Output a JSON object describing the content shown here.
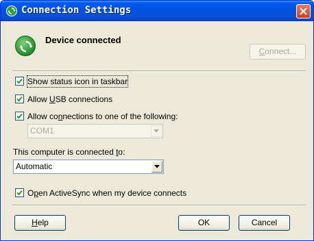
{
  "window": {
    "title": "Connection Settings",
    "colors": {
      "titlebar": "#0054e3",
      "close": "#c9401e",
      "face": "#ece9d8",
      "icon_green": "#1f8f2b"
    },
    "icons": [
      "sync-icon",
      "close-icon"
    ]
  },
  "status": {
    "title": "Device connected",
    "connect_button": {
      "label_pre": "",
      "mnemonic": "C",
      "label_post": "onnect...",
      "enabled": false
    }
  },
  "options": {
    "show_status_icon": {
      "label": "Show status icon in taskbar",
      "checked": true
    },
    "allow_usb": {
      "label_pre": "Allow ",
      "mnemonic": "U",
      "label_post": "SB connections",
      "checked": true
    },
    "allow_connections": {
      "label_pre": "Allow co",
      "mnemonic": "n",
      "label_post": "nections to one of the following:",
      "checked": true
    },
    "port_select": {
      "value": "COM1",
      "enabled": false
    },
    "connected_to_label": {
      "label_pre": "This computer is connected ",
      "mnemonic": "t",
      "label_post": "o:"
    },
    "connected_to_select": {
      "value": "Automatic"
    },
    "open_activesync": {
      "label_pre": "O",
      "mnemonic": "p",
      "label_post": "en ActiveSync when my device connects",
      "checked": true
    }
  },
  "footer": {
    "help": {
      "label_pre": "",
      "mnemonic": "H",
      "label_post": "elp"
    },
    "ok": {
      "label": "OK"
    },
    "cancel": {
      "label": "Cancel"
    }
  }
}
